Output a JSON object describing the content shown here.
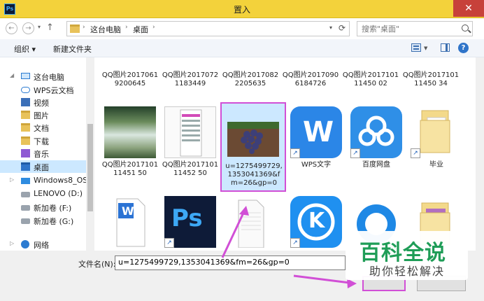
{
  "window": {
    "title": "置入",
    "app_badge": "Ps",
    "close_glyph": "✕"
  },
  "nav": {
    "back": "←",
    "forward": "→",
    "up": "↑"
  },
  "address": {
    "crumbs": [
      "这台电脑",
      "桌面"
    ],
    "search_placeholder": "搜索\"桌面\""
  },
  "toolbar": {
    "organize": "组织 ▾",
    "new_folder": "新建文件夹",
    "help": "?"
  },
  "sidebar": {
    "items": [
      {
        "label": "这台电脑",
        "icon": "computer-icon"
      },
      {
        "label": "WPS云文档",
        "icon": "cloud-icon"
      },
      {
        "label": "视频",
        "icon": "video-icon"
      },
      {
        "label": "图片",
        "icon": "pictures-icon"
      },
      {
        "label": "文档",
        "icon": "documents-icon"
      },
      {
        "label": "下载",
        "icon": "downloads-icon"
      },
      {
        "label": "音乐",
        "icon": "music-icon"
      },
      {
        "label": "桌面",
        "icon": "desktop-icon",
        "selected": true
      },
      {
        "label": "Windows8_OS (C:)",
        "icon": "drive-icon"
      },
      {
        "label": "LENOVO (D:)",
        "icon": "drive-icon"
      },
      {
        "label": "新加卷 (F:)",
        "icon": "drive-icon"
      },
      {
        "label": "新加卷 (G:)",
        "icon": "drive-icon"
      },
      {
        "label": "网络",
        "icon": "network-icon"
      }
    ]
  },
  "files": {
    "row1": [
      "QQ图片20170619200645",
      "QQ图片20170721183449",
      "QQ图片20170822205635",
      "QQ图片20170906184726",
      "QQ图片201710111450 02",
      "QQ图片201710111450 34"
    ],
    "row2": [
      "QQ图片201710111451 50",
      "QQ图片201710111452 50",
      "u=1275499729,1353041369&fm=26&gp=0",
      "WPS文字",
      "百度网盘",
      "毕业"
    ],
    "row2_chars": {
      "wps": "W",
      "ps": "Ps",
      "kugou": "K"
    }
  },
  "footer": {
    "filename_label": "文件名(N):",
    "filename_value": "u=1275499729,1353041369&fm=26&gp=0"
  },
  "watermark": {
    "main": "百科全说",
    "sub": "助你轻松解决"
  }
}
